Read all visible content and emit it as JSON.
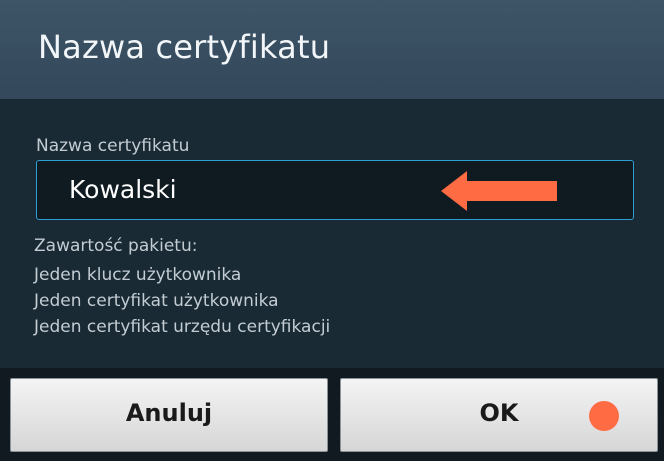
{
  "dialog": {
    "title": "Nazwa certyfikatu",
    "field_label": "Nazwa certyfikatu",
    "input_value": "Kowalski",
    "package_header": "Zawartość pakietu:",
    "package_items": [
      "Jeden klucz użytkownika",
      "Jeden certyfikat użytkownika",
      "Jeden certyfikat urzędu certyfikacji"
    ]
  },
  "buttons": {
    "cancel_label": "Anuluj",
    "ok_label": "OK"
  },
  "annotations": {
    "arrow_color": "#ff6b42",
    "dot_color": "#ff6b42",
    "arrow_icon": "arrow-left-icon",
    "dot_icon": "circle-marker-icon"
  },
  "colors": {
    "title_bar": "#3d5567",
    "background": "#192a35",
    "input_border": "#2e9fd3",
    "text": "#c3ccd2"
  }
}
